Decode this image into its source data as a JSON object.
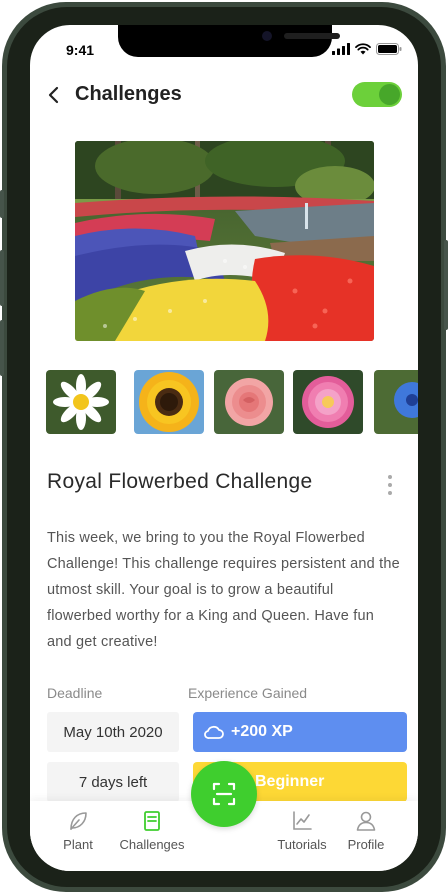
{
  "status": {
    "time": "9:41"
  },
  "header": {
    "title": "Challenges",
    "notifications_on": true
  },
  "challenge": {
    "title": "Royal Flowerbed Challenge",
    "description": "This week, we bring to you the Royal Flowerbed Challenge! This challenge requires persistent and the utmost skill. Your goal is to grow a beautiful flowerbed worthy for a King and Queen. Have fun and get creative!",
    "thumbnails": [
      "daisy",
      "sunflower",
      "rose",
      "dahlia",
      "cornflower"
    ],
    "deadline_label": "Deadline",
    "deadline": "May 10th 2020",
    "days_left": "7 days left",
    "experience_label": "Experience Gained",
    "xp": "+200 XP",
    "level": "Beginner"
  },
  "nav": {
    "items": [
      {
        "label": "Plant",
        "icon": "leaf-icon"
      },
      {
        "label": "Challenges",
        "icon": "book-icon",
        "active": true
      },
      {
        "label": "Tutorials",
        "icon": "chart-icon"
      },
      {
        "label": "Profile",
        "icon": "user-icon"
      }
    ],
    "scan_icon": "scan-icon"
  },
  "colors": {
    "accent_green": "#3fce2e",
    "xp_blue": "#5e8ef0",
    "level_yellow": "#fdd835"
  }
}
